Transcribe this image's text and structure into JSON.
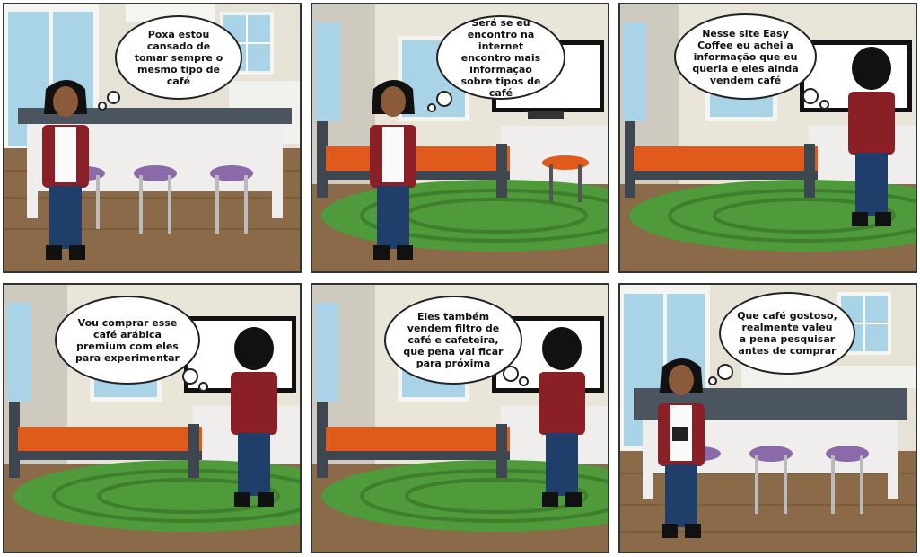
{
  "panels": [
    {
      "id": 1,
      "scene": "kitchen",
      "character": "front-sad",
      "text": "Poxa estou cansado de tomar sempre o mesmo tipo de café"
    },
    {
      "id": 2,
      "scene": "bedroom",
      "character": "front",
      "text": "Será se eu encontro na internet encontro mais informação sobre tipos de café"
    },
    {
      "id": 3,
      "scene": "bedroom",
      "character": "back",
      "text": "Nesse site Easy Coffee eu achei a informação que eu queria e eles ainda vendem café"
    },
    {
      "id": 4,
      "scene": "bedroom",
      "character": "back",
      "text": "Vou comprar esse café arábica premium com eles para experimentar"
    },
    {
      "id": 5,
      "scene": "bedroom",
      "character": "back",
      "text": "Eles também vendem filtro de café e cafeteira, que pena vai ficar para próxima"
    },
    {
      "id": 6,
      "scene": "kitchen",
      "character": "front-cup",
      "text": "Que café gostoso, realmente valeu a pena pesquisar antes de comprar"
    }
  ],
  "colors": {
    "wall": "#e9e5d9",
    "floor": "#8a6a48",
    "rug": "#4f9a3a",
    "counter": "#4a5560",
    "stool": "#8a6aa8",
    "jacket": "#8a1f25",
    "jeans": "#1f3f6a",
    "hair": "#111111"
  }
}
